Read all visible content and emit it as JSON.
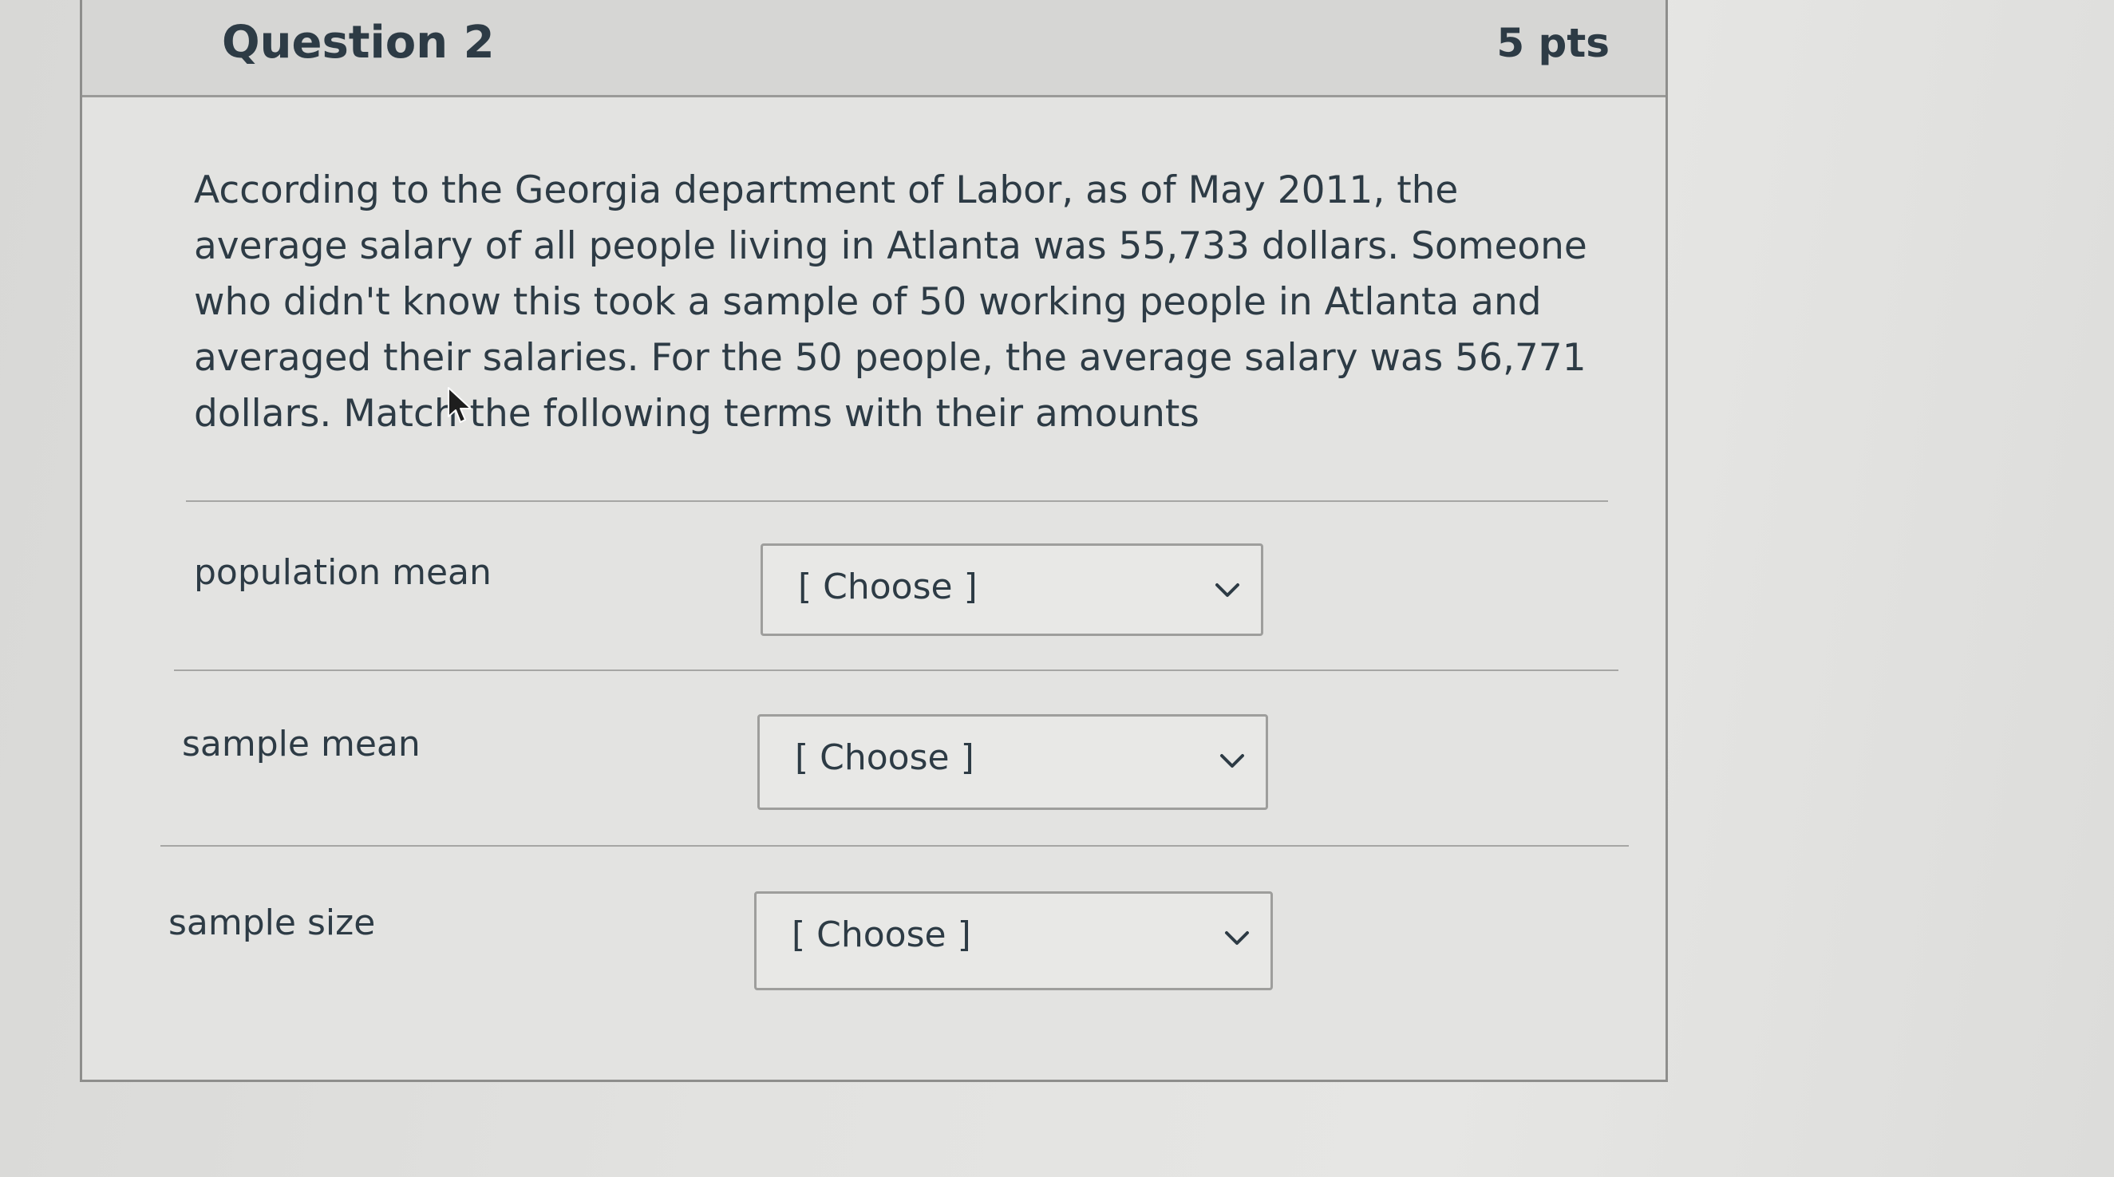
{
  "question": {
    "title": "Question 2",
    "points": "5 pts",
    "text": "According to the Georgia department of Labor, as of May 2011, the average salary of all people living in Atlanta was 55,733 dollars. Someone who didn't know this took a sample of 50 working people in Atlanta and averaged their salaries. For the 50 people, the average salary was 56,771 dollars. Match the following terms with their amounts"
  },
  "matches": [
    {
      "label": "population mean",
      "selected": "[ Choose ]"
    },
    {
      "label": "sample mean",
      "selected": "[ Choose ]"
    },
    {
      "label": "sample size",
      "selected": "[ Choose ]"
    }
  ],
  "icons": {
    "flag": "flag-icon",
    "dropdown": "chevron-down-icon",
    "cursor": "mouse-pointer-icon"
  },
  "colors": {
    "text": "#2d3b45",
    "header_bg": "#d6d6d4",
    "card_bg": "#e3e3e1",
    "border": "#8e8e8c"
  }
}
